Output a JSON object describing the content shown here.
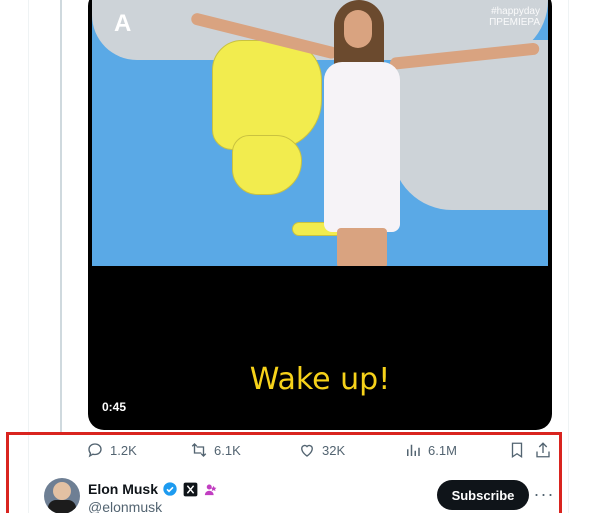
{
  "media": {
    "channel_logo": "A",
    "broadcast_tag_line1": "#happyday",
    "broadcast_tag_line2": "ΠΡΕΜΙΕΡΑ",
    "caption": "Wake up!",
    "duration": "0:45"
  },
  "actions": {
    "replies": "1.2K",
    "reposts": "6.1K",
    "likes": "32K",
    "views": "6.1M"
  },
  "author": {
    "display_name": "Elon Musk",
    "handle": "@elonmusk",
    "subscribe_label": "Subscribe",
    "more_label": "···"
  },
  "colors": {
    "highlight_border": "#d9241f",
    "verified_blue": "#1d9bf0",
    "affiliate_pink": "#c13ec1",
    "caption_yellow": "#f6d21a",
    "muted_text": "#536471"
  },
  "icons": {
    "reply": "reply-icon",
    "repost": "repost-icon",
    "like": "heart-icon",
    "views": "views-chart-icon",
    "bookmark": "bookmark-icon",
    "share": "share-icon",
    "verified": "verified-badge-icon",
    "affiliate": "x-affiliate-icon",
    "person": "person-badge-icon"
  }
}
